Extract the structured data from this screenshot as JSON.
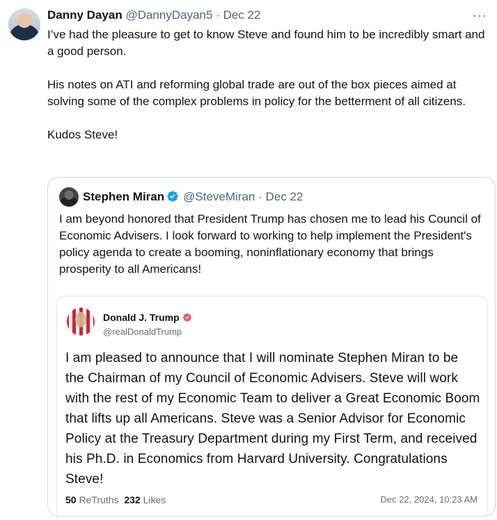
{
  "post": {
    "author_name": "Danny Dayan",
    "author_handle": "@DannyDayan5",
    "separator": "·",
    "date": "Dec 22",
    "paragraphs": [
      "I’ve had the pleasure to get to know Steve and found him to be incredibly smart and a good person.",
      "His notes on ATI and reforming global trade are out of the box pieces aimed at solving some of the complex problems in policy for the betterment of all citizens.",
      "Kudos Steve!"
    ],
    "more_icon": "more-horizontal-icon"
  },
  "quote": {
    "author_name": "Stephen Miran",
    "author_handle": "@SteveMiran",
    "separator": "·",
    "date": "Dec 22",
    "verified_icon": "verified-badge-icon",
    "text": "I am beyond honored that President Trump has chosen me to lead his Council of Economic Advisers.  I look forward to working to help implement the President's policy agenda to create a booming, noninflationary economy that brings prosperity to all Americans!"
  },
  "truth": {
    "author_name": "Donald J. Trump",
    "author_handle": "@realDonaldTrump",
    "verified_icon": "verified-check-icon",
    "text": "I am pleased to announce that I will nominate Stephen Miran to be the Chairman of my Council of Economic Advisers. Steve will work with the rest of my Economic Team to deliver a Great Economic Boom that lifts up all Americans. Steve was a Senior Advisor for Economic Policy at the Treasury Department during my First Term, and received his Ph.D. in Economics from Harvard University. Congratulations Steve!",
    "retruths_count": "50",
    "retruths_label": "ReTruths",
    "likes_count": "232",
    "likes_label": "Likes",
    "timestamp": "Dec 22, 2024, 10:23 AM"
  },
  "colors": {
    "x_verified": "#1d9bf0",
    "truth_verified": "#e95a69"
  }
}
